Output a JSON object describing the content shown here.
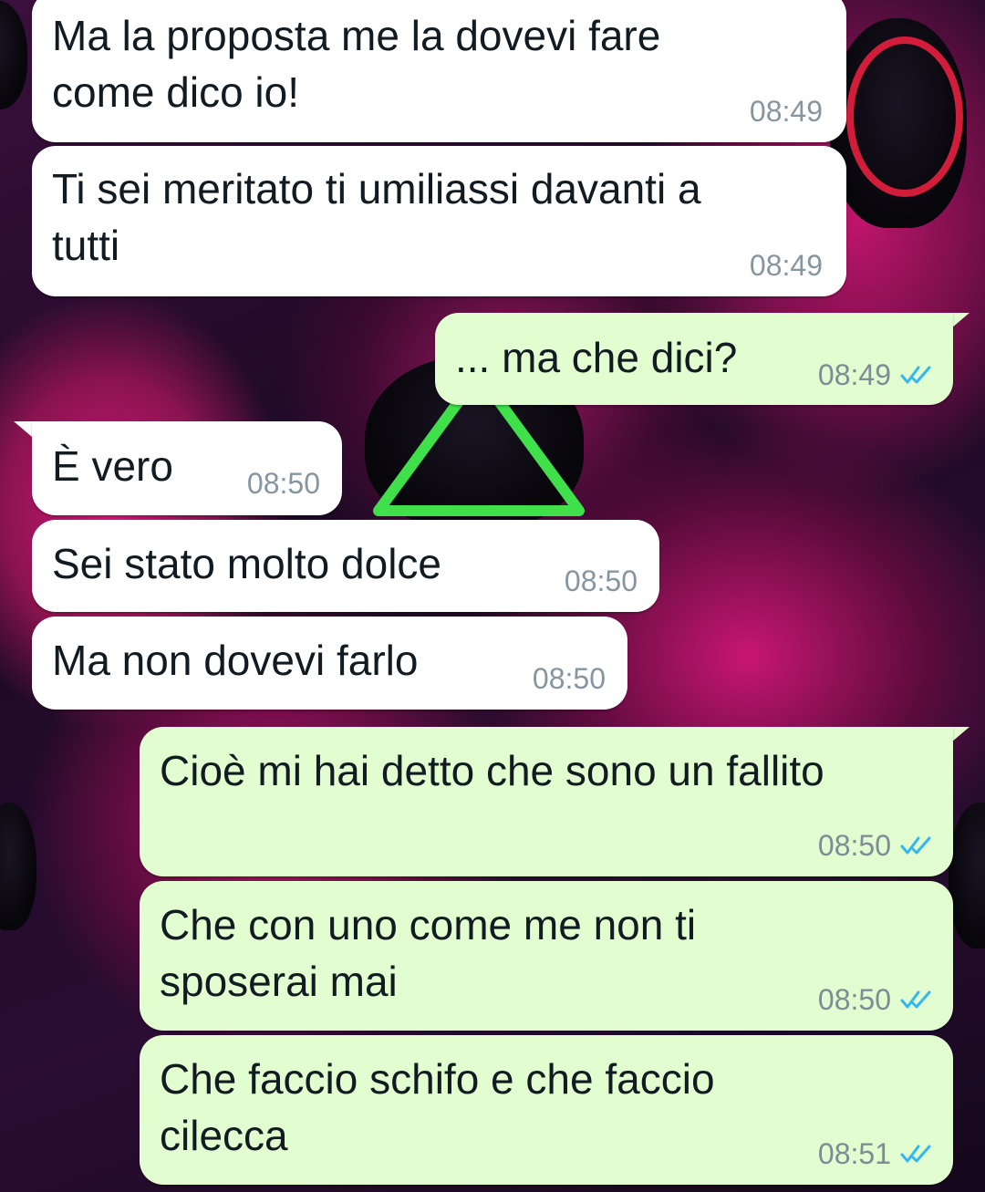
{
  "chat": {
    "messages": [
      {
        "direction": "in",
        "text": "Ma la proposta me la dovevi fare\ncome dico io!",
        "time": "08:49"
      },
      {
        "direction": "in",
        "text": "Ti sei meritato ti umiliassi davanti a\ntutti",
        "time": "08:49"
      },
      {
        "direction": "out",
        "text": "... ma che dici?",
        "time": "08:49",
        "status_icon": "double-check-read-icon"
      },
      {
        "direction": "in",
        "text": "È vero",
        "time": "08:50"
      },
      {
        "direction": "in",
        "text": "Sei stato molto dolce",
        "time": "08:50"
      },
      {
        "direction": "in",
        "text": "Ma non dovevi farlo",
        "time": "08:50"
      },
      {
        "direction": "out",
        "text": "Cioè mi hai detto che sono un fallito",
        "time": "08:50",
        "status_icon": "double-check-read-icon"
      },
      {
        "direction": "out",
        "text": "Che con uno come me non ti\nsposerai mai",
        "time": "08:50",
        "status_icon": "double-check-read-icon"
      },
      {
        "direction": "out",
        "text": "Che faccio schifo e che faccio\ncilecca",
        "time": "08:51",
        "status_icon": "double-check-read-icon"
      }
    ]
  },
  "colors": {
    "incoming_bubble": "#ffffff",
    "outgoing_bubble": "#e2fdd0",
    "read_check": "#34b7f1",
    "timestamp": "#8696a0"
  }
}
